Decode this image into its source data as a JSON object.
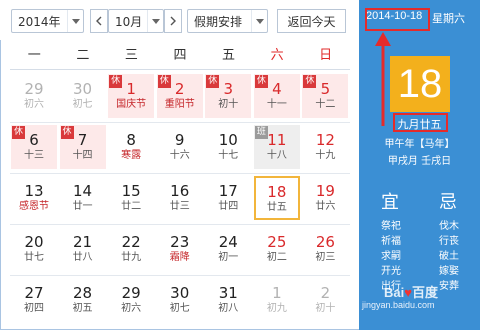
{
  "toolbar": {
    "year": "2014年",
    "month": "10月",
    "holiday": "假期安排",
    "today_button": "返回今天"
  },
  "weekdays": [
    "一",
    "二",
    "三",
    "四",
    "五",
    "六",
    "日"
  ],
  "weeks": [
    [
      {
        "day": "29",
        "sub": "初六",
        "other": true
      },
      {
        "day": "30",
        "sub": "初七",
        "other": true
      },
      {
        "day": "1",
        "sub": "国庆节",
        "holiday": true,
        "badge": "休",
        "fest": true,
        "red": true
      },
      {
        "day": "2",
        "sub": "重阳节",
        "holiday": true,
        "badge": "休",
        "fest": true,
        "red": true
      },
      {
        "day": "3",
        "sub": "初十",
        "holiday": true,
        "badge": "休",
        "red": true
      },
      {
        "day": "4",
        "sub": "十一",
        "holiday": true,
        "badge": "休",
        "red": true
      },
      {
        "day": "5",
        "sub": "十二",
        "holiday": true,
        "badge": "休",
        "red": true
      }
    ],
    [
      {
        "day": "6",
        "sub": "十三",
        "holiday": true,
        "badge": "休"
      },
      {
        "day": "7",
        "sub": "十四",
        "holiday": true,
        "badge": "休"
      },
      {
        "day": "8",
        "sub": "寒露",
        "fest": true
      },
      {
        "day": "9",
        "sub": "十六"
      },
      {
        "day": "10",
        "sub": "十七"
      },
      {
        "day": "11",
        "sub": "十八",
        "workday": true,
        "badge": "班",
        "red": true
      },
      {
        "day": "12",
        "sub": "十九",
        "red": true
      }
    ],
    [
      {
        "day": "13",
        "sub": "感恩节",
        "fest": true
      },
      {
        "day": "14",
        "sub": "廿一"
      },
      {
        "day": "15",
        "sub": "廿二"
      },
      {
        "day": "16",
        "sub": "廿三"
      },
      {
        "day": "17",
        "sub": "廿四"
      },
      {
        "day": "18",
        "sub": "廿五",
        "today": true,
        "red": true
      },
      {
        "day": "19",
        "sub": "廿六",
        "red": true
      }
    ],
    [
      {
        "day": "20",
        "sub": "廿七"
      },
      {
        "day": "21",
        "sub": "廿八"
      },
      {
        "day": "22",
        "sub": "廿九"
      },
      {
        "day": "23",
        "sub": "霜降",
        "fest": true
      },
      {
        "day": "24",
        "sub": "初一"
      },
      {
        "day": "25",
        "sub": "初二",
        "red": true
      },
      {
        "day": "26",
        "sub": "初三",
        "red": true
      }
    ],
    [
      {
        "day": "27",
        "sub": "初四"
      },
      {
        "day": "28",
        "sub": "初五"
      },
      {
        "day": "29",
        "sub": "初六"
      },
      {
        "day": "30",
        "sub": "初七"
      },
      {
        "day": "31",
        "sub": "初八"
      },
      {
        "day": "1",
        "sub": "初九",
        "other": true
      },
      {
        "day": "2",
        "sub": "初十",
        "other": true
      }
    ]
  ],
  "panel": {
    "date": "2014-10-18",
    "weekday": "星期六",
    "big_day": "18",
    "lunar": "九月廿五",
    "ganzhi_year": "甲午年【马年】",
    "ganzhi_month_day": "甲戌月 壬戌日",
    "yi": "宜",
    "ji": "忌",
    "yi_items": [
      "祭祀",
      "祈福",
      "求嗣",
      "开光",
      "出行"
    ],
    "ji_items": [
      "伐木",
      "行丧",
      "破土",
      "嫁娶",
      "安葬"
    ]
  },
  "watermark": {
    "logo": "Bai♥百度",
    "url": "jingyan.baidu.com"
  },
  "colors": {
    "panel_bg": "#3b8fd4",
    "today_border": "#f2b53b",
    "big_day_bg": "#f3b01c",
    "holiday_bg": "#fde9e9",
    "weekend_red": "#d9292b",
    "highlight_red": "#e42b2b"
  }
}
